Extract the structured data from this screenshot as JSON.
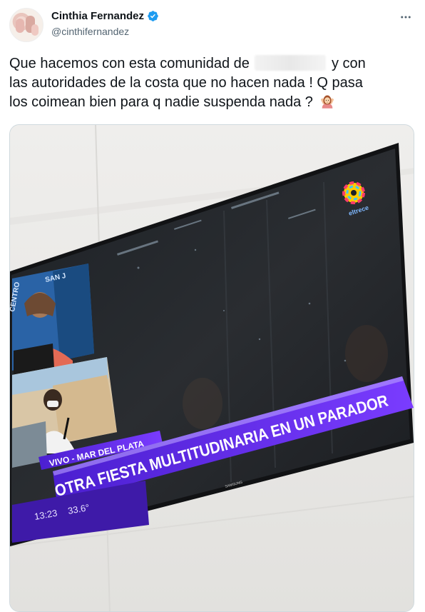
{
  "user": {
    "display_name": "Cinthia Fernandez",
    "handle": "@cinthifernandez",
    "avatar_icon": "profile-photo",
    "verified": true,
    "verified_color": "#1d9bf0"
  },
  "menu": {
    "icon": "more-horizontal-icon"
  },
  "tweet": {
    "line1_before": "Que hacemos con esta comunidad de",
    "line1_after": "y con",
    "line2": "las autoridades de la costa que no hacen nada ! Q pasa",
    "line3": "los coimean bien para q nadie suspenda nada ?",
    "emoji": "person-gesturing-ok-emoji"
  },
  "media": {
    "channel_logo_text": "eltrece",
    "location_label": "VIVO - MAR DEL PLATA",
    "headline": "OTRA FIESTA MULTITUDINARIA EN UN PARADOR",
    "time": "13:23",
    "temperature": "33.6°",
    "sign_text": "CENTRO",
    "sign_text2": "SAN J",
    "brand_text": "SAMSUNG",
    "accent_color": "#6b2bff",
    "panel_color": "#3e1aa8"
  }
}
